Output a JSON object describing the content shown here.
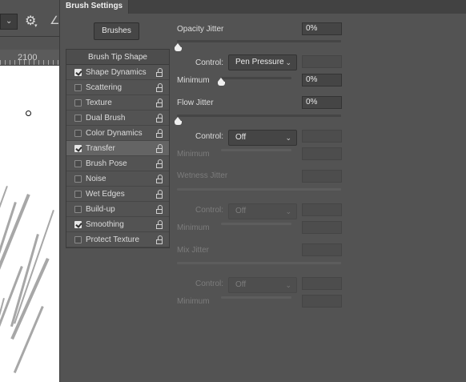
{
  "panel": {
    "tab_title": "Brush Settings",
    "brushes_button": "Brushes"
  },
  "ruler": {
    "label": "2100"
  },
  "options": {
    "header": "Brush Tip Shape",
    "items": [
      {
        "label": "Shape Dynamics",
        "checked": true,
        "active": false
      },
      {
        "label": "Scattering",
        "checked": false,
        "active": false
      },
      {
        "label": "Texture",
        "checked": false,
        "active": false
      },
      {
        "label": "Dual Brush",
        "checked": false,
        "active": false
      },
      {
        "label": "Color Dynamics",
        "checked": false,
        "active": false
      },
      {
        "label": "Transfer",
        "checked": true,
        "active": true
      },
      {
        "label": "Brush Pose",
        "checked": false,
        "active": false
      },
      {
        "label": "Noise",
        "checked": false,
        "active": false
      },
      {
        "label": "Wet Edges",
        "checked": false,
        "active": false
      },
      {
        "label": "Build-up",
        "checked": false,
        "active": false
      },
      {
        "label": "Smoothing",
        "checked": true,
        "active": false
      },
      {
        "label": "Protect Texture",
        "checked": false,
        "active": false
      }
    ]
  },
  "transfer": {
    "opacity_jitter": {
      "label": "Opacity Jitter",
      "value": "0%",
      "level": 0
    },
    "opacity_control": {
      "label": "Control:",
      "selected": "Pen Pressure"
    },
    "opacity_minimum": {
      "label": "Minimum",
      "value": "0%",
      "level": 0
    },
    "flow_jitter": {
      "label": "Flow Jitter",
      "value": "0%",
      "level": 0
    },
    "flow_control": {
      "label": "Control:",
      "selected": "Off"
    },
    "flow_minimum": {
      "label": "Minimum"
    },
    "wetness_jitter": {
      "label": "Wetness Jitter"
    },
    "wetness_control": {
      "label": "Control:",
      "selected": "Off"
    },
    "wetness_minimum": {
      "label": "Minimum"
    },
    "mix_jitter": {
      "label": "Mix Jitter"
    },
    "mix_control": {
      "label": "Control:",
      "selected": "Off"
    },
    "mix_minimum": {
      "label": "Minimum"
    }
  },
  "icons": {
    "lock": "lock-icon",
    "chevron": "chevron-down-icon",
    "gear": "gear-icon"
  }
}
